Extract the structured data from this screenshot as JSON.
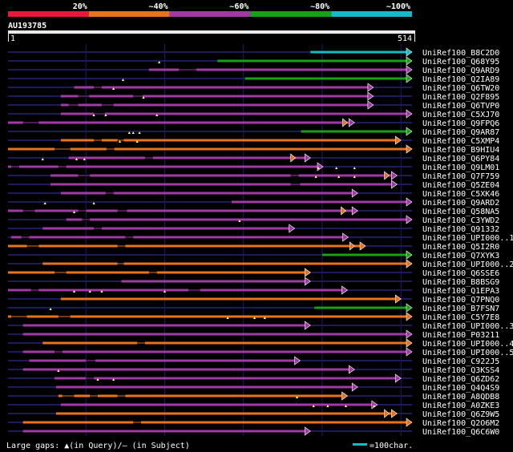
{
  "colors": {
    "background": "#000000",
    "grid": "#1a1a7a",
    "c20": "#e6193c",
    "c40": "#e8731c",
    "c60": "#a13aa6",
    "c80": "#17a117",
    "c100": "#17b8c8",
    "gap_marker": "#ffff66",
    "scale_bar": "#e8e8e8"
  },
  "legend_top": [
    "20%",
    "~40%",
    "~60%",
    "~80%",
    "~100%"
  ],
  "query": {
    "id": "AU193785",
    "start_label": "1",
    "end_label": "514",
    "length": 514
  },
  "footer": {
    "gaps_text": "Large gaps: ▲(in Query)/— (in Subject)",
    "scale_text": "=100char."
  },
  "chart_data": {
    "type": "alignment",
    "x_range": [
      1,
      514
    ],
    "hits": [
      {
        "label": "UniRef100_B8C2D0",
        "start": 385,
        "end": 514,
        "cls": "c100",
        "gaps": [],
        "subj": []
      },
      {
        "label": "UniRef100_Q68Y95",
        "start": 267,
        "end": 514,
        "cls": "c80",
        "gaps": [],
        "subj": []
      },
      {
        "label": "UniRef100_Q9ARD9",
        "start": 180,
        "end": 514,
        "cls": "c60",
        "gaps": [
          193
        ],
        "subj": [
          [
            218,
            240
          ]
        ]
      },
      {
        "label": "UniRef100_Q2IA89",
        "start": 302,
        "end": 514,
        "cls": "c80",
        "gaps": [],
        "subj": []
      },
      {
        "label": "UniRef100_Q6TW20",
        "start": 85,
        "end": 465,
        "cls": "c60",
        "gaps": [
          147
        ],
        "subj": [
          [
            110,
            120
          ]
        ]
      },
      {
        "label": "UniRef100_Q2F895",
        "start": 68,
        "end": 465,
        "cls": "c60",
        "gaps": [
          135
        ],
        "subj": [
          [
            90,
            104
          ],
          [
            160,
            172
          ]
        ]
      },
      {
        "label": "UniRef100_Q6TVP0",
        "start": 68,
        "end": 465,
        "cls": "c60",
        "gaps": [
          173
        ],
        "subj": [
          [
            78,
            90
          ],
          [
            120,
            135
          ]
        ]
      },
      {
        "label": "UniRef100_C5XJ70",
        "start": 68,
        "end": 514,
        "cls": "c60",
        "gaps": [],
        "subj": [
          [
            110,
            124
          ]
        ]
      },
      {
        "label": "UniRef100_Q9FPQ6",
        "start": 1,
        "end": 441,
        "cls": "c60",
        "gaps": [
          110,
          125,
          190
        ],
        "subj": [
          [
            20,
            40
          ]
        ],
        "tip": [
          432,
          441
        ]
      },
      {
        "label": "UniRef100_Q9AR87",
        "start": 373,
        "end": 514,
        "cls": "c80",
        "gaps": [],
        "subj": []
      },
      {
        "label": "UniRef100_C5XMP4",
        "start": 68,
        "end": 500,
        "cls": "c40",
        "gaps": [
          155,
          160,
          168
        ],
        "subj": [
          [
            110,
            120
          ],
          [
            140,
            148
          ]
        ]
      },
      {
        "label": "UniRef100_B9HIU4",
        "start": 1,
        "end": 514,
        "cls": "c40",
        "gaps": [
          143,
          165
        ],
        "subj": [
          [
            60,
            80
          ],
          [
            126,
            136
          ]
        ]
      },
      {
        "label": "UniRef100_Q6PY84",
        "start": 78,
        "end": 385,
        "cls": "c60",
        "gaps": [],
        "subj": [
          [
            175,
            185
          ]
        ],
        "tip": [
          366,
          385
        ]
      },
      {
        "label": "UniRef100_Q9LM01",
        "start": 1,
        "end": 401,
        "cls": "c60",
        "gaps": [
          45,
          88,
          98
        ],
        "subj": [
          [
            5,
            15
          ],
          [
            65,
            75
          ]
        ]
      },
      {
        "label": "UniRef100_Q7F759",
        "start": 55,
        "end": 495,
        "cls": "c60",
        "gaps": [
          395,
          418,
          441
        ],
        "subj": [
          [
            90,
            105
          ],
          [
            360,
            370
          ]
        ],
        "tip": [
          485,
          495
        ]
      },
      {
        "label": "UniRef100_Q5ZE04",
        "start": 55,
        "end": 495,
        "cls": "c60",
        "gaps": [
          392,
          421,
          441
        ],
        "subj": [
          [
            360,
            372
          ]
        ]
      },
      {
        "label": "UniRef100_C5XK46",
        "start": 68,
        "end": 445,
        "cls": "c60",
        "gaps": [],
        "subj": [
          [
            125,
            135
          ]
        ]
      },
      {
        "label": "UniRef100_Q9ARD2",
        "start": 285,
        "end": 514,
        "cls": "c60",
        "gaps": [],
        "subj": []
      },
      {
        "label": "UniRef100_Q58NA5",
        "start": 1,
        "end": 445,
        "cls": "c60",
        "gaps": [
          48,
          110
        ],
        "subj": [
          [
            20,
            35
          ],
          [
            90,
            100
          ],
          [
            140,
            152
          ]
        ],
        "tip": [
          430,
          445
        ]
      },
      {
        "label": "UniRef100_C3YWD2",
        "start": 75,
        "end": 514,
        "cls": "c60",
        "gaps": [
          85
        ],
        "subj": [
          [
            95,
            105
          ]
        ]
      },
      {
        "label": "UniRef100_Q91332",
        "start": 45,
        "end": 365,
        "cls": "c60",
        "gaps": [
          295
        ],
        "subj": [
          [
            110,
            120
          ]
        ]
      },
      {
        "label": "UniRef100_UPI000..1",
        "start": 5,
        "end": 433,
        "cls": "c60",
        "gaps": [],
        "subj": [
          [
            18,
            28
          ],
          [
            150,
            160
          ]
        ]
      },
      {
        "label": "UniRef100_Q5I2R0",
        "start": 1,
        "end": 455,
        "cls": "c40",
        "gaps": [],
        "subj": [
          [
            25,
            40
          ],
          [
            140,
            150
          ]
        ],
        "tip": [
          441,
          455
        ]
      },
      {
        "label": "UniRef100_Q7XYK3",
        "start": 400,
        "end": 514,
        "cls": "c80",
        "gaps": [],
        "subj": []
      },
      {
        "label": "UniRef100_UPI000..2",
        "start": 45,
        "end": 514,
        "cls": "c40",
        "gaps": [],
        "subj": [
          [
            140,
            148
          ]
        ]
      },
      {
        "label": "UniRef100_Q6SSE6",
        "start": 1,
        "end": 385,
        "cls": "c40",
        "gaps": [],
        "subj": [
          [
            60,
            75
          ],
          [
            180,
            190
          ]
        ]
      },
      {
        "label": "UniRef100_B8BSG9",
        "start": 145,
        "end": 385,
        "cls": "c60",
        "gaps": [],
        "subj": []
      },
      {
        "label": "UniRef100_Q1EPA3",
        "start": 1,
        "end": 432,
        "cls": "c60",
        "gaps": [],
        "subj": [
          [
            30,
            40
          ],
          [
            230,
            245
          ]
        ]
      },
      {
        "label": "UniRef100_Q7PNQ0",
        "start": 68,
        "end": 500,
        "cls": "c40",
        "gaps": [
          85,
          105,
          120,
          200
        ],
        "subj": []
      },
      {
        "label": "UniRef100_B7FSN7",
        "start": 390,
        "end": 514,
        "cls": "c80",
        "gaps": [],
        "subj": []
      },
      {
        "label": "UniRef100_C5Y7E8",
        "start": 1,
        "end": 514,
        "cls": "c40",
        "gaps": [
          55
        ],
        "subj": [
          [
            5,
            25
          ],
          [
            65,
            80
          ]
        ]
      },
      {
        "label": "UniRef100_UPI000..3",
        "start": 20,
        "end": 385,
        "cls": "c60",
        "gaps": [
          280,
          314,
          327
        ],
        "subj": []
      },
      {
        "label": "UniRef100_P03211",
        "start": 20,
        "end": 514,
        "cls": "c60",
        "gaps": [],
        "subj": []
      },
      {
        "label": "UniRef100_UPI000..4",
        "start": 45,
        "end": 514,
        "cls": "c40",
        "gaps": [],
        "subj": [
          [
            165,
            175
          ]
        ]
      },
      {
        "label": "UniRef100_UPI000..5",
        "start": 20,
        "end": 514,
        "cls": "c60",
        "gaps": [],
        "subj": [
          [
            60,
            70
          ]
        ]
      },
      {
        "label": "UniRef100_C922J5",
        "start": 28,
        "end": 372,
        "cls": "c60",
        "gaps": [],
        "subj": [
          [
            100,
            112
          ]
        ]
      },
      {
        "label": "UniRef100_Q3KSS4",
        "start": 20,
        "end": 441,
        "cls": "c60",
        "gaps": [],
        "subj": []
      },
      {
        "label": "UniRef100_Q6ZD62",
        "start": 60,
        "end": 500,
        "cls": "c60",
        "gaps": [
          65
        ],
        "subj": [
          [
            100,
            110
          ]
        ]
      },
      {
        "label": "UniRef100_Q4Q4S9",
        "start": 62,
        "end": 445,
        "cls": "c60",
        "gaps": [
          115,
          135
        ],
        "subj": []
      },
      {
        "label": "UniRef100_A8QDB8",
        "start": 65,
        "end": 432,
        "cls": "c40",
        "gaps": [],
        "subj": [
          [
            70,
            85
          ],
          [
            105,
            115
          ],
          [
            140,
            150
          ]
        ]
      },
      {
        "label": "UniRef100_A0ZKE3",
        "start": 68,
        "end": 470,
        "cls": "c60",
        "gaps": [
          368
        ],
        "subj": []
      },
      {
        "label": "UniRef100_Q6Z9W5",
        "start": 62,
        "end": 495,
        "cls": "c40",
        "gaps": [
          389,
          407,
          430,
          466
        ],
        "subj": [],
        "tip": [
          485,
          495
        ]
      },
      {
        "label": "UniRef100_Q2O6M2",
        "start": 20,
        "end": 514,
        "cls": "c40",
        "gaps": [],
        "subj": [
          [
            160,
            170
          ]
        ]
      },
      {
        "label": "UniRef100_Q6C6W0",
        "start": 20,
        "end": 385,
        "cls": "c60",
        "gaps": [],
        "subj": []
      }
    ]
  }
}
